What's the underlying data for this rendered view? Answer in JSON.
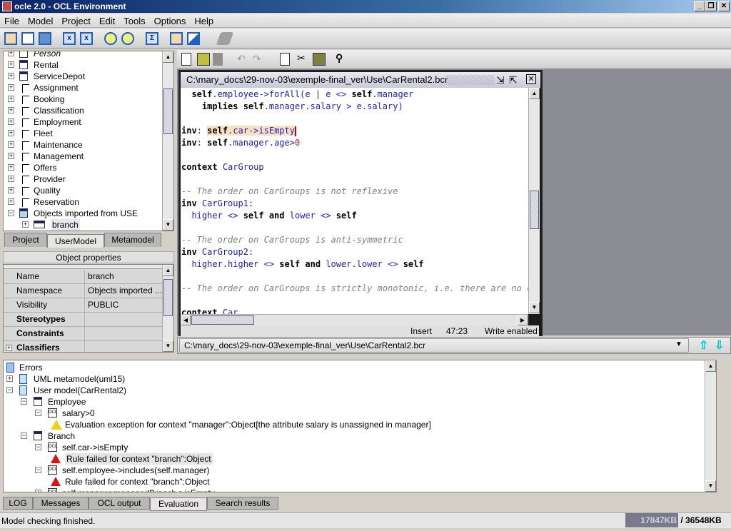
{
  "window": {
    "title": "ocle 2.0 - OCL Environment",
    "minimize": "_",
    "restore": "❐",
    "close": "✕"
  },
  "menu": [
    "File",
    "Model",
    "Project",
    "Edit",
    "Tools",
    "Options",
    "Help"
  ],
  "toolbar1_icons": [
    "new-project-icon",
    "open-project-icon",
    "save-project-icon",
    "import-xmi-icon",
    "export-xmi-icon",
    "check-model-icon",
    "check-ocl-icon",
    "evaluate-expression-icon",
    "class-diagram-icon",
    "usecase-diagram-icon",
    "disabled-action-icon"
  ],
  "model_tree": {
    "items": [
      {
        "label": "Person",
        "type": "class",
        "italic": true
      },
      {
        "label": "Rental",
        "type": "class"
      },
      {
        "label": "ServiceDepot",
        "type": "class"
      },
      {
        "label": "Assignment",
        "type": "association"
      },
      {
        "label": "Booking",
        "type": "association"
      },
      {
        "label": "Classification",
        "type": "association"
      },
      {
        "label": "Employment",
        "type": "association"
      },
      {
        "label": "Fleet",
        "type": "association"
      },
      {
        "label": "Maintenance",
        "type": "association"
      },
      {
        "label": "Management",
        "type": "association"
      },
      {
        "label": "Offers",
        "type": "association"
      },
      {
        "label": "Provider",
        "type": "association"
      },
      {
        "label": "Quality",
        "type": "association"
      },
      {
        "label": "Reservation",
        "type": "association"
      },
      {
        "label": "Objects imported from USE",
        "type": "package",
        "expanded": true
      },
      {
        "label": "branch",
        "type": "object",
        "selected": true
      }
    ]
  },
  "left_tabs": [
    {
      "label": "Project",
      "active": false
    },
    {
      "label": "UserModel",
      "active": true
    },
    {
      "label": "Metamodel",
      "active": false
    }
  ],
  "object_properties": {
    "header": "Object properties",
    "rows": [
      {
        "key": "Name",
        "value": "branch",
        "bold": false
      },
      {
        "key": "Namespace",
        "value": "Objects imported ...",
        "bold": false
      },
      {
        "key": "Visibility",
        "value": "PUBLIC",
        "bold": false
      },
      {
        "key": "Stereotypes",
        "value": "",
        "bold": true
      },
      {
        "key": "Constraints",
        "value": "",
        "bold": true
      },
      {
        "key": "Classifiers",
        "value": "",
        "bold": true,
        "expandable": true
      }
    ]
  },
  "editor_toolbar_icons": [
    "new-file-icon",
    "open-file-icon",
    "save-file-icon",
    "undo-icon",
    "redo-icon",
    "copy-icon",
    "cut-icon",
    "paste-icon",
    "find-icon"
  ],
  "editor": {
    "title": "C:\\mary_docs\\29-nov-03\\exemple-final_ver\\Use\\CarRental2.bcr",
    "mode": "Insert",
    "position": "47:23",
    "write_state": "Write enabled"
  },
  "path_combo": {
    "value": "C:\\mary_docs\\29-nov-03\\exemple-final_ver\\Use\\CarRental2.bcr"
  },
  "errors_tree": {
    "root": "Errors",
    "items": [
      {
        "label": "UML metamodel(uml15)",
        "level": 0,
        "icon": "doc",
        "toggle": "+"
      },
      {
        "label": "User model(CarRental2)",
        "level": 0,
        "icon": "doc",
        "toggle": "-"
      },
      {
        "label": "Employee",
        "level": 1,
        "icon": "class",
        "toggle": "-"
      },
      {
        "label": "salary>0",
        "level": 2,
        "icon": "ocl",
        "toggle": "-"
      },
      {
        "label": "Evaluation exception for context \"manager\":Object[the attribute salary is unassigned in manager]",
        "level": 3,
        "icon": "warning"
      },
      {
        "label": "Branch",
        "level": 1,
        "icon": "class",
        "toggle": "-"
      },
      {
        "label": "self.car->isEmpty",
        "level": 2,
        "icon": "ocl",
        "toggle": "-"
      },
      {
        "label": "Rule failed for context \"branch\":Object",
        "level": 3,
        "icon": "error",
        "selected": true
      },
      {
        "label": "self.employee->includes(self.manager)",
        "level": 2,
        "icon": "ocl",
        "toggle": "-"
      },
      {
        "label": "Rule failed for context \"branch\":Object",
        "level": 3,
        "icon": "error"
      },
      {
        "label": "self.manager.managedBranch->isEmpty",
        "level": 2,
        "icon": "ocl",
        "toggle": "+"
      }
    ]
  },
  "bottom_tabs": [
    {
      "label": "LOG",
      "active": false
    },
    {
      "label": "Messages",
      "active": false
    },
    {
      "label": "OCL output",
      "active": false
    },
    {
      "label": "Evaluation",
      "active": true
    },
    {
      "label": "Search results",
      "active": false
    }
  ],
  "status": {
    "message": "Model checking finished.",
    "memory_used": "17847KB",
    "memory_separator": " / ",
    "memory_total": "36548KB"
  },
  "colors": {
    "keyword": "#000000",
    "identifier": "#2020c0",
    "number": "#e02020",
    "comment": "#808080",
    "highlight": "#fde0c0",
    "title_start": "#0a246a",
    "title_end": "#a6caf0"
  }
}
